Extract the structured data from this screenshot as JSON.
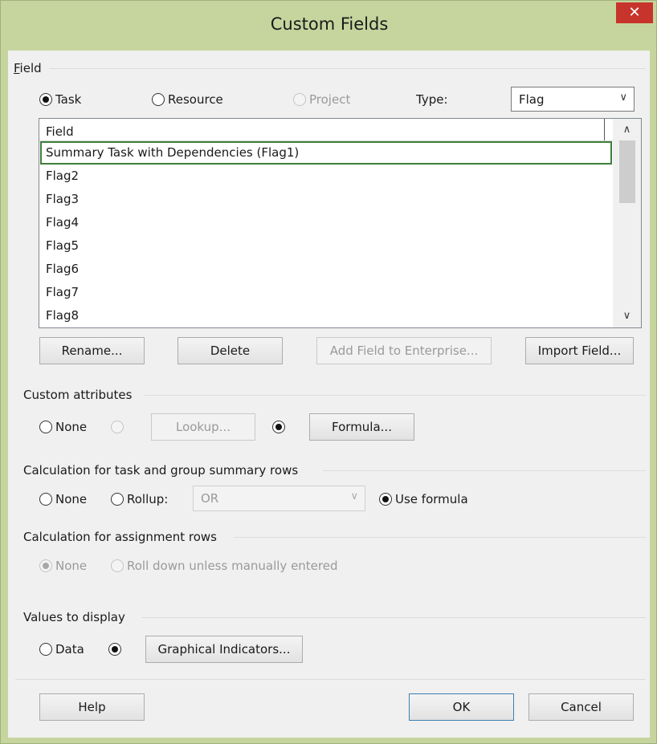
{
  "window": {
    "title": "Custom Fields",
    "close_glyph": "✕"
  },
  "field_section": {
    "label": "Field",
    "accesskey": "F",
    "label_rest": "ield",
    "radios": [
      {
        "label": "Task",
        "checked": true,
        "disabled": false
      },
      {
        "label": "Resource",
        "checked": false,
        "disabled": false
      },
      {
        "label": "Project",
        "checked": false,
        "disabled": true
      }
    ],
    "type_label": "Type:",
    "type_value": "Flag",
    "list": {
      "header": "Field",
      "rows": [
        "Summary Task with Dependencies (Flag1)",
        "Flag2",
        "Flag3",
        "Flag4",
        "Flag5",
        "Flag6",
        "Flag7",
        "Flag8"
      ],
      "selected_index": 0
    },
    "buttons": {
      "rename": "Rename...",
      "delete": "Delete",
      "add_enterprise": "Add Field to Enterprise...",
      "import": "Import Field..."
    }
  },
  "custom_attributes": {
    "label": "Custom attributes",
    "none_label": "None",
    "lookup_label": "Lookup...",
    "formula_label": "Formula...",
    "selected": "formula"
  },
  "calc_summary": {
    "label": "Calculation for task and group summary rows",
    "none_label": "None",
    "rollup_label": "Rollup:",
    "rollup_value": "OR",
    "use_formula_label": "Use formula",
    "selected": "use_formula"
  },
  "calc_assignment": {
    "label": "Calculation for assignment rows",
    "none_label": "None",
    "rolldown_label": "Roll down unless manually entered",
    "selected": "none"
  },
  "values_display": {
    "label": "Values to display",
    "data_label": "Data",
    "graphical_label": "Graphical Indicators...",
    "selected": "graphical"
  },
  "footer": {
    "help": "Help",
    "ok": "OK",
    "cancel": "Cancel"
  },
  "colors": {
    "titlebar": "#c6d59e",
    "close": "#c7342c",
    "selection_border": "#3f7f3b"
  }
}
